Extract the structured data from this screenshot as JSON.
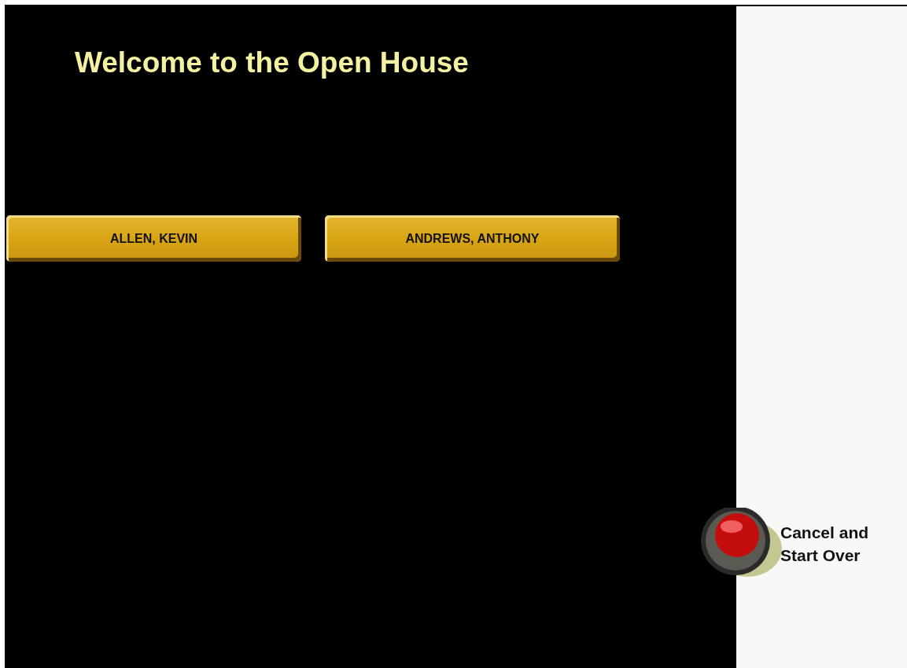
{
  "title": "Welcome to the Open House",
  "names": [
    "ALLEN, KEVIN",
    "ANDREWS, ANTHONY"
  ],
  "cancel": {
    "label_lines": [
      "Cancel and",
      "Start Over"
    ]
  }
}
